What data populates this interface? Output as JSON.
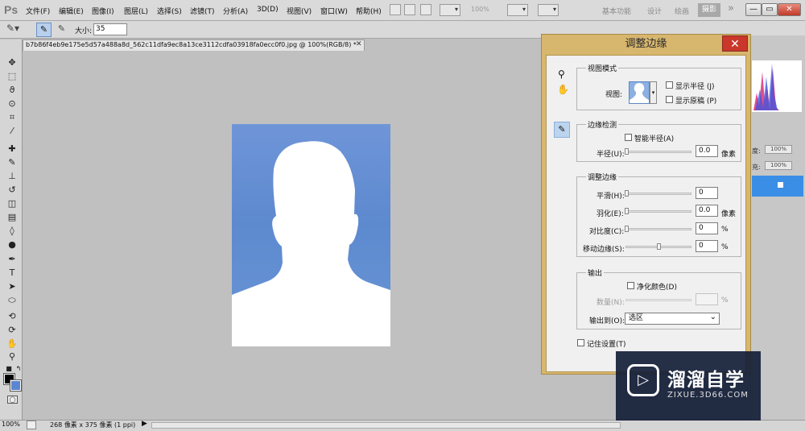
{
  "app": {
    "logo": "Ps"
  },
  "menu": [
    "文件(F)",
    "编辑(E)",
    "图像(I)",
    "图层(L)",
    "选择(S)",
    "滤镜(T)",
    "分析(A)",
    "3D(D)",
    "视图(V)",
    "窗口(W)",
    "帮助(H)"
  ],
  "menubar": {
    "zoom": "100%",
    "workspaces": [
      "基本功能",
      "设计",
      "绘画"
    ],
    "active_workspace": "摄影",
    "more": "»"
  },
  "window_buttons": {
    "minimize": "—",
    "restore": "▭",
    "close": "✕"
  },
  "options": {
    "size_label": "大小:",
    "size_value": "35"
  },
  "document": {
    "tab_title": "b7b86f4eb9e175e5d57a488a8d_562c11dfa9ec8a13ce3112cdfa03918fa0ecc0f0.jpg @ 100%(RGB/8) *",
    "close": "✕"
  },
  "status": {
    "zoom": "100%",
    "info": "268 像素 x 375 像素 (1 ppi)",
    "arrow": "▶"
  },
  "panels": {
    "opacity_label_1": "度:",
    "opacity_value_1": "100%",
    "opacity_label_2": "充:",
    "opacity_value_2": "100%"
  },
  "dialog": {
    "title": "调整边缘",
    "close": "✕",
    "view_mode": {
      "group": "视图模式",
      "view_label": "视图:",
      "show_radius": "显示半径 (J)",
      "show_original": "显示原稿 (P)"
    },
    "edge_detection": {
      "group": "边缘检测",
      "smart_radius": "智能半径(A)",
      "radius_label": "半径(U):",
      "radius_value": "0.0",
      "radius_unit": "像素"
    },
    "adjust_edge": {
      "group": "调整边缘",
      "smooth_label": "平滑(H):",
      "smooth_value": "0",
      "feather_label": "羽化(E):",
      "feather_value": "0.0",
      "feather_unit": "像素",
      "contrast_label": "对比度(C):",
      "contrast_value": "0",
      "contrast_unit": "%",
      "shift_label": "移动边缘(S):",
      "shift_value": "0",
      "shift_unit": "%"
    },
    "output": {
      "group": "输出",
      "decontaminate": "净化颜色(D)",
      "amount_label": "数量(N):",
      "amount_unit": "%",
      "output_to_label": "输出到(O):",
      "output_to_value": "选区"
    },
    "remember": "记住设置(T)"
  },
  "watermark": {
    "name": "溜溜自学",
    "url": "ZIXUE.3D66.COM",
    "logo_symbol": "▷"
  },
  "colors": {
    "dialog_frame": "#d7b66d",
    "close_red": "#c9382b",
    "photo_blue": "#5d89cf",
    "layer_selected": "#3b8ee5"
  }
}
